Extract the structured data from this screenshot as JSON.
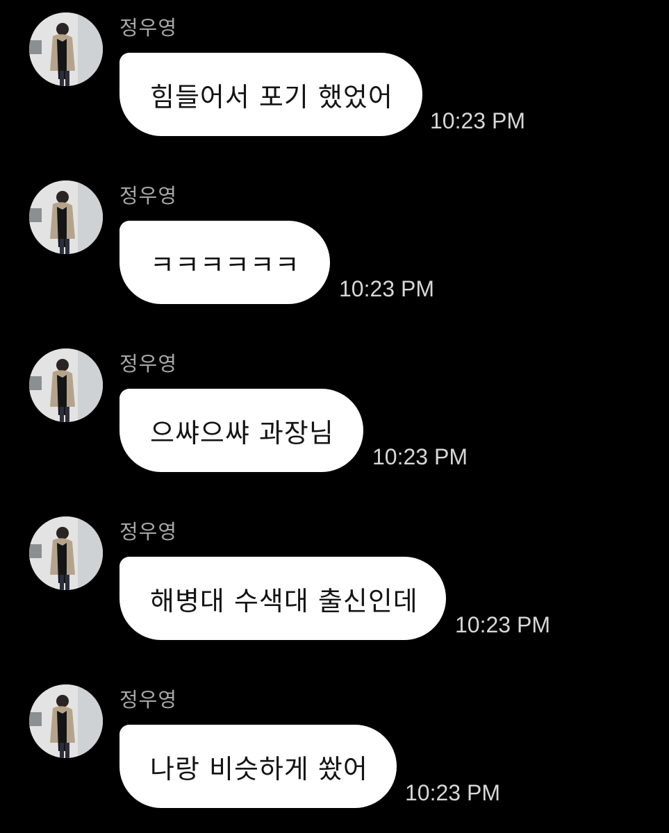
{
  "messages": [
    {
      "sender": "정우영",
      "text": "힘들어서 포기 했었어",
      "time": "10:23 PM"
    },
    {
      "sender": "정우영",
      "text": "ㅋㅋㅋㅋㅋㅋ",
      "time": "10:23 PM"
    },
    {
      "sender": "정우영",
      "text": "으쌰으쌰 과장님",
      "time": "10:23 PM"
    },
    {
      "sender": "정우영",
      "text": "해병대 수색대 출신인데",
      "time": "10:23 PM"
    },
    {
      "sender": "정우영",
      "text": "나랑 비슷하게 쐈어",
      "time": "10:23 PM"
    }
  ],
  "colors": {
    "background": "#000000",
    "bubble": "#ffffff",
    "bubble_text": "#141414",
    "sender_name": "#a8a8a8",
    "timestamp": "#d7d7d7"
  },
  "icons": {
    "avatar": "profile-photo-avatar"
  }
}
